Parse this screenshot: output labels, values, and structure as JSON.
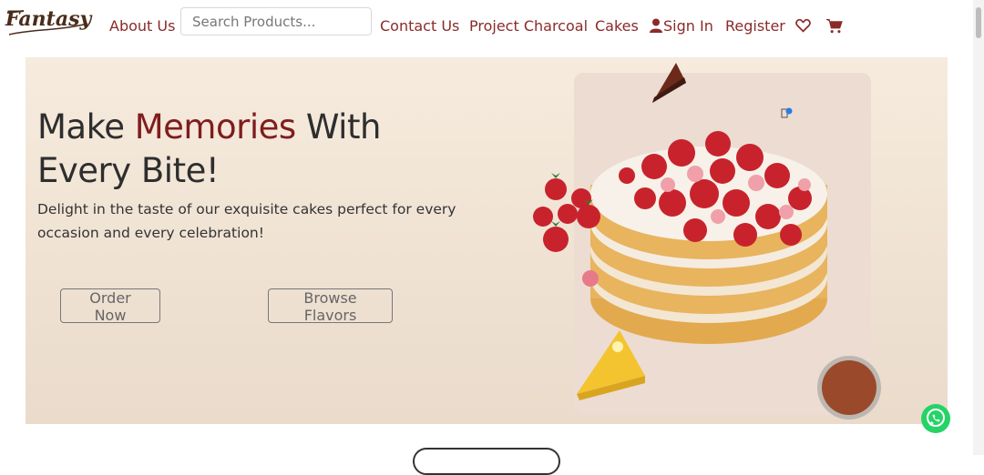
{
  "brand": {
    "logo_text": "Fantasy"
  },
  "nav": {
    "about": "About Us",
    "search_placeholder": "Search Products...",
    "contact": "Contact Us",
    "project": "Project Charcoal",
    "cakes": "Cakes",
    "signin": "Sign In",
    "register": "Register",
    "icons": [
      "user-icon",
      "heart-icon",
      "cart-icon"
    ]
  },
  "hero": {
    "title_part1": "Make ",
    "title_accent": "Memories",
    "title_part2": " With Every Bite!",
    "description": "Delight in the taste of our exquisite cakes perfect for every occasion and every celebration!",
    "order_button": "Order Now",
    "browse_button": "Browse Flavors"
  },
  "colors": {
    "brand": "#8b2a2a",
    "accent": "#7f1d1d",
    "hero_bg": "#f6ebdd",
    "whatsapp": "#25d366"
  }
}
